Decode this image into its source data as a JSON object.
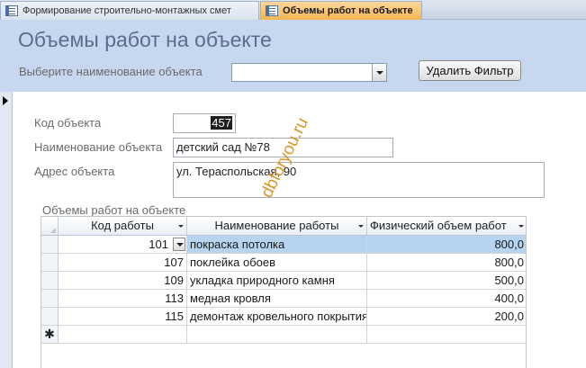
{
  "tabs": [
    {
      "label": "Формирование строительно-монтажных смет",
      "active": false
    },
    {
      "label": "Объемы работ на объекте",
      "active": true
    }
  ],
  "header": {
    "title": "Объемы работ на объекте",
    "select_label": "Выберите наименование объекта",
    "select_value": "",
    "filter_button": "Удалить Фильтр"
  },
  "record": {
    "code_label": "Код объекта",
    "code_value": "457",
    "name_label": "Наименование объекта",
    "name_value": "детский сад №78",
    "address_label": "Адрес объекта",
    "address_value": "ул. Тераспольская, 90"
  },
  "subform": {
    "label": "Объемы работ на объекте",
    "columns": [
      "Код работы",
      "Наименование работы",
      "Физический объем работ"
    ],
    "rows": [
      {
        "code": "101",
        "name": "покраска потолка",
        "volume": "800,0"
      },
      {
        "code": "107",
        "name": "поклейка обоев",
        "volume": "800,0"
      },
      {
        "code": "109",
        "name": "укладка природного камня",
        "volume": "500,0"
      },
      {
        "code": "113",
        "name": "медная кровля",
        "volume": "400,0"
      },
      {
        "code": "115",
        "name": "демонтаж кровельного покрытия",
        "volume": "200,0"
      }
    ],
    "new_row_marker": "✱"
  },
  "watermark": "dbforyou.ru",
  "colors": {
    "header_bg": "#c6d7ef",
    "active_tab": "#f6b553",
    "selected_cell": "#b6d3ef",
    "watermark": "#d88c12"
  }
}
